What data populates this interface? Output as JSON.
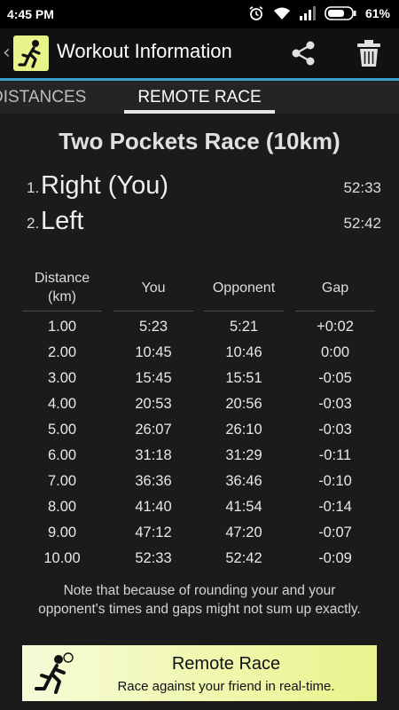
{
  "status_bar": {
    "time": "4:45 PM",
    "battery": "61%",
    "icons": [
      "alarm-icon",
      "wifi-icon",
      "signal-icon",
      "battery-icon"
    ]
  },
  "app_bar": {
    "back_glyph": "‹",
    "title": "Workout Information",
    "actions": [
      "share-icon",
      "trash-icon"
    ]
  },
  "tabs": [
    {
      "label": "DISTANCES",
      "selected": false
    },
    {
      "label": "REMOTE RACE",
      "selected": true
    }
  ],
  "race": {
    "title": "Two Pockets Race (10km)",
    "results": [
      {
        "rank": "1.",
        "name": "Right (You)",
        "time": "52:33"
      },
      {
        "rank": "2.",
        "name": "Left",
        "time": "52:42"
      }
    ]
  },
  "table": {
    "headers": [
      "Distance (km)",
      "You",
      "Opponent",
      "Gap"
    ],
    "rows": [
      [
        "1.00",
        "5:23",
        "5:21",
        "+0:02"
      ],
      [
        "2.00",
        "10:45",
        "10:46",
        "0:00"
      ],
      [
        "3.00",
        "15:45",
        "15:51",
        "-0:05"
      ],
      [
        "4.00",
        "20:53",
        "20:56",
        "-0:03"
      ],
      [
        "5.00",
        "26:07",
        "26:10",
        "-0:03"
      ],
      [
        "6.00",
        "31:18",
        "31:29",
        "-0:11"
      ],
      [
        "7.00",
        "36:36",
        "36:46",
        "-0:10"
      ],
      [
        "8.00",
        "41:40",
        "41:54",
        "-0:14"
      ],
      [
        "9.00",
        "47:12",
        "47:20",
        "-0:07"
      ],
      [
        "10.00",
        "52:33",
        "52:42",
        "-0:09"
      ]
    ]
  },
  "note": "Note that because of rounding your and your opponent's times and gaps might not sum up exactly.",
  "promo": {
    "title": "Remote Race",
    "subtitle": "Race against your friend in real-time.",
    "icon": "running-man-icon"
  },
  "colors": {
    "background": "#1b1b1b",
    "accent_line": "#3aa0c8",
    "promo_start": "#f7fbd8",
    "promo_end": "#e8f48c",
    "app_icon_bg": "#e7f48a"
  }
}
